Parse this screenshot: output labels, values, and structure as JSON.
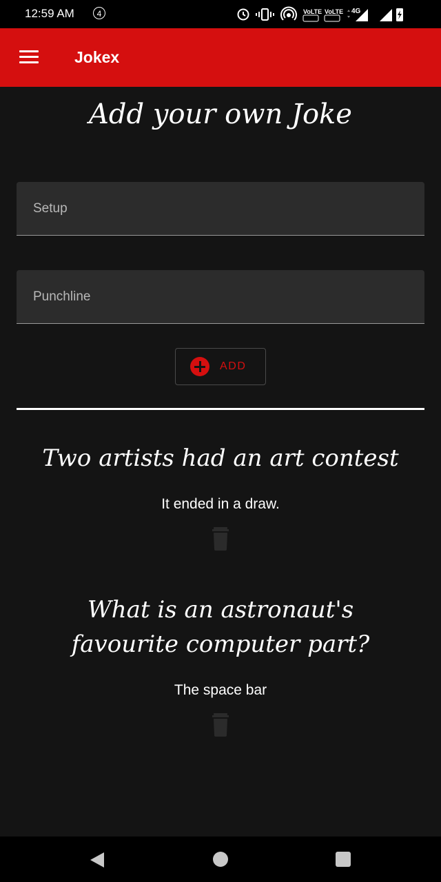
{
  "status_bar": {
    "time": "12:59 AM",
    "notification_count": "4",
    "network_label": "4G",
    "volte_1": "VoLTE",
    "volte_2": "VoLTE"
  },
  "app_bar": {
    "title": "Jokex",
    "menu_icon": "hamburger-menu-icon"
  },
  "form": {
    "title": "Add your own Joke",
    "setup_placeholder": "Setup",
    "setup_value": "",
    "punchline_placeholder": "Punchline",
    "punchline_value": "",
    "add_label": "ADD",
    "add_icon": "plus-circle-icon",
    "accent_color": "#d50f0f"
  },
  "jokes": [
    {
      "setup": "Two artists had an art contest",
      "punchline": "It ended in a draw.",
      "delete_icon": "trash-icon"
    },
    {
      "setup": "What is an astronaut's favourite computer part?",
      "punchline": "The space bar",
      "delete_icon": "trash-icon"
    }
  ],
  "nav_bar": {
    "back_icon": "back-triangle-icon",
    "home_icon": "home-circle-icon",
    "recents_icon": "recents-square-icon"
  }
}
